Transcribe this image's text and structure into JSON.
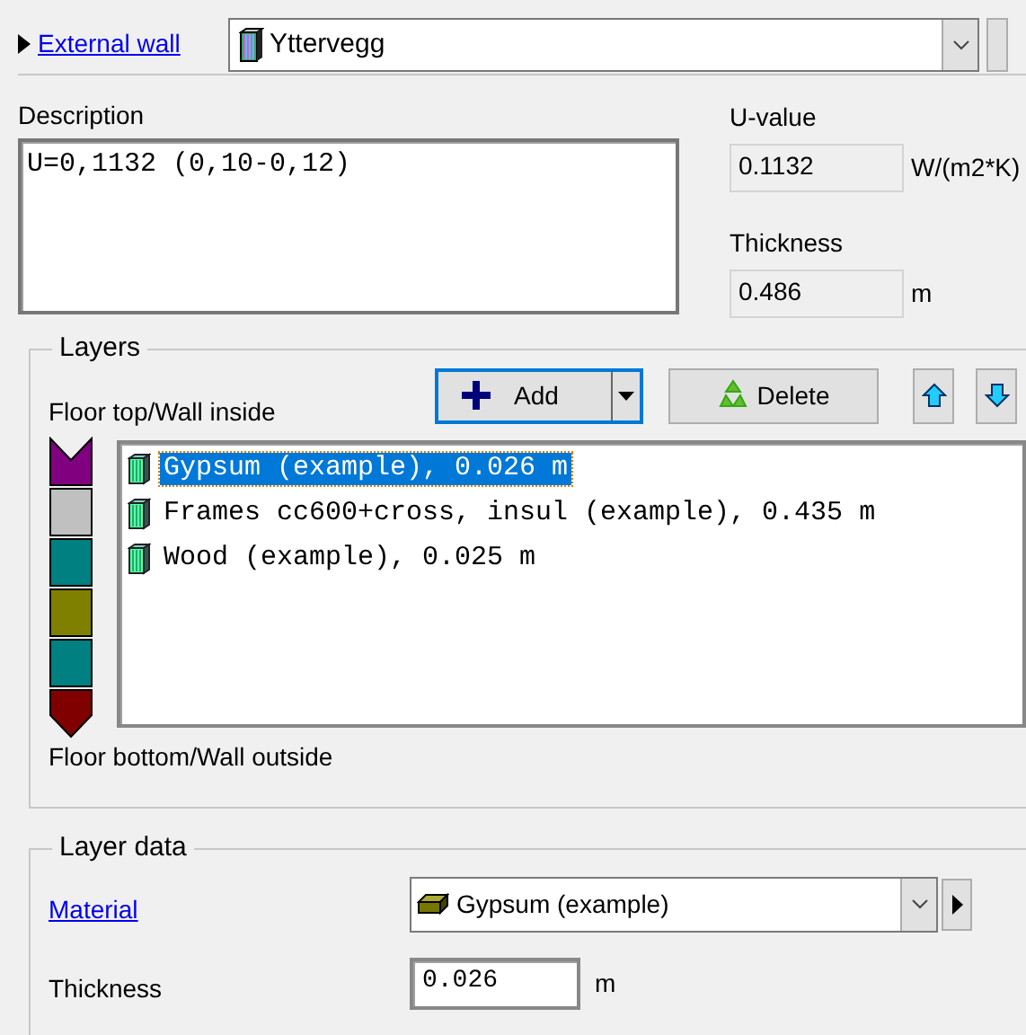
{
  "header": {
    "link": "External wall",
    "construction": "Yttervegg"
  },
  "description": {
    "label": "Description",
    "value": "U=0,1132 (0,10-0,12)"
  },
  "u_value": {
    "label": "U-value",
    "value": "0.1132",
    "unit": "W/(m2*K)"
  },
  "thickness": {
    "label": "Thickness",
    "value": "0.486",
    "unit": "m"
  },
  "layers": {
    "title": "Layers",
    "top_label": "Floor top/Wall inside",
    "bottom_label": "Floor bottom/Wall outside",
    "buttons": [
      {
        "kind": "add",
        "label": "Add"
      },
      {
        "kind": "delete",
        "label": "Delete"
      },
      {
        "kind": "up"
      },
      {
        "kind": "down"
      }
    ],
    "strip": [
      {
        "color": "#800080"
      },
      {
        "color": "#c0c0c0"
      },
      {
        "color": "#008080"
      },
      {
        "color": "#808000"
      },
      {
        "color": "#008080"
      },
      {
        "color": "#800000"
      }
    ],
    "items": [
      {
        "label": "Gypsum (example), 0.026 m",
        "selected": true
      },
      {
        "label": "Frames cc600+cross, insul (example), 0.435 m",
        "selected": false
      },
      {
        "label": "Wood (example), 0.025 m",
        "selected": false
      }
    ]
  },
  "layer_data": {
    "title": "Layer data",
    "material_link": "Material",
    "material": "Gypsum (example)",
    "thickness_label": "Thickness",
    "thickness": "0.026",
    "thickness_unit": "m"
  }
}
